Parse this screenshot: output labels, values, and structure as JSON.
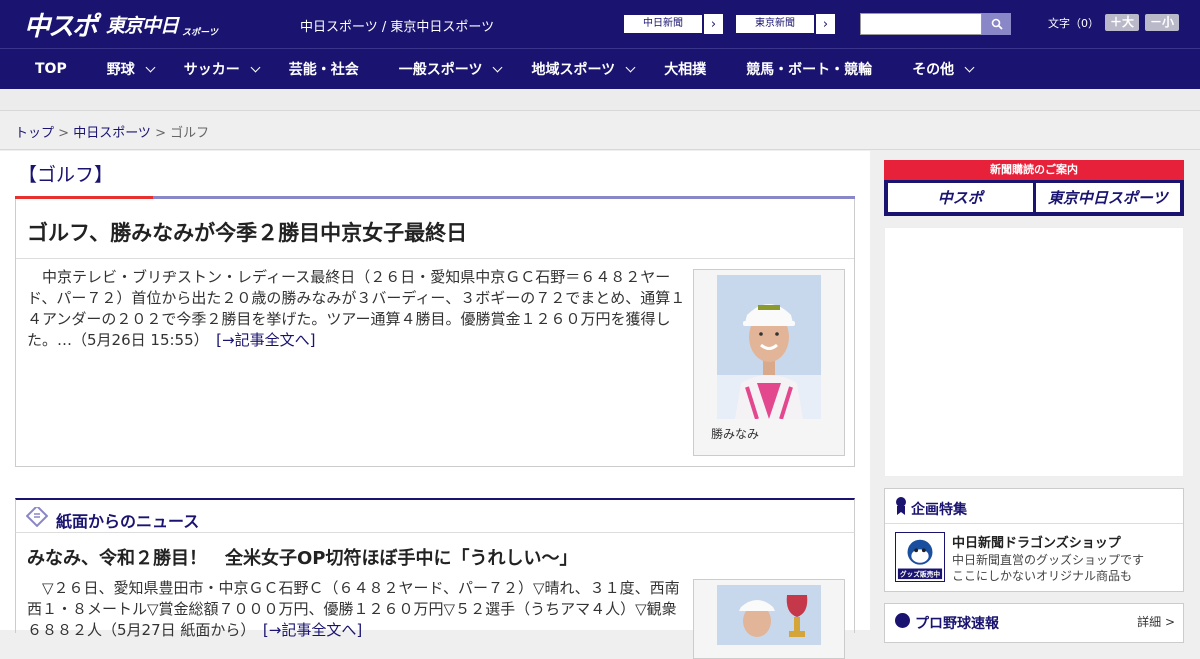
{
  "header": {
    "logo_chu": "中スポ",
    "logo_tokyo": "東京中日",
    "logo_sports": "スポーツ",
    "site_links": "中日スポーツ / 東京中日スポーツ",
    "ext_links": [
      "中日新聞",
      "東京新聞"
    ],
    "search_placeholder": "",
    "font_label": "文字（0）",
    "font_bigger": "＋大",
    "font_smaller": "－小"
  },
  "nav": [
    {
      "label": "TOP",
      "dropdown": false
    },
    {
      "label": "野球",
      "dropdown": true
    },
    {
      "label": "サッカー",
      "dropdown": true
    },
    {
      "label": "芸能・社会",
      "dropdown": false
    },
    {
      "label": "一般スポーツ",
      "dropdown": true
    },
    {
      "label": "地域スポーツ",
      "dropdown": true
    },
    {
      "label": "大相撲",
      "dropdown": false
    },
    {
      "label": "競馬・ボート・競輪",
      "dropdown": false
    },
    {
      "label": "その他",
      "dropdown": true
    }
  ],
  "breadcrumb": {
    "home": "トップ",
    "sep": " > ",
    "parent": "中日スポーツ",
    "current": "ゴルフ"
  },
  "category": {
    "title": "【ゴルフ】"
  },
  "article1": {
    "headline": "ゴルフ、勝みなみが今季２勝目中京女子最終日",
    "body": "　中京テレビ・ブリヂストン・レディース最終日（２６日・愛知県中京ＧＣ石野＝６４８２ヤード、パー７２）首位から出た２０歳の勝みなみが３バーディー、３ボギーの７２でまとめ、通算１４アンダーの２０２で今季２勝目を挙げた。ツアー通算４勝目。優勝賞金１２６０万円を獲得した。…（5月26日 15:55）",
    "more": "[→記事全文へ]",
    "caption": "勝みなみ"
  },
  "section2": {
    "title": "紙面からのニュース",
    "headline": "みなみ、令和２勝目！　全米女子OP切符ほぼ手中に「うれしい～」",
    "body": "　▽２６日、愛知県豊田市・中京ＧＣ石野Ｃ（６４８２ヤード、パー７２）▽晴れ、３１度、西南西１・８メートル▽賞金総額７０００万円、優勝１２６０万円▽５２選手（うちアマ４人）▽観衆６８８２人（5月27日 紙面から）",
    "more": "[→記事全文へ]"
  },
  "sidebar": {
    "subscribe_label": "新聞購読のご案内",
    "subscribe_btn1": "中スポ",
    "subscribe_btn2": "東京中日スポーツ",
    "promo_title": "企画特集",
    "promo_name": "中日新聞ドラゴンズショップ",
    "promo_desc1": "中日新聞直営のグッズショップです",
    "promo_desc2": "ここにしかないオリジナル商品も",
    "promo_thumb_text": "グッズ販売中",
    "baseball_title": "プロ野球速報",
    "baseball_more": "詳細 >"
  },
  "colors": {
    "brand": "#1a1470",
    "accent_red": "#e8312f",
    "accent_light": "#8a87c8"
  }
}
